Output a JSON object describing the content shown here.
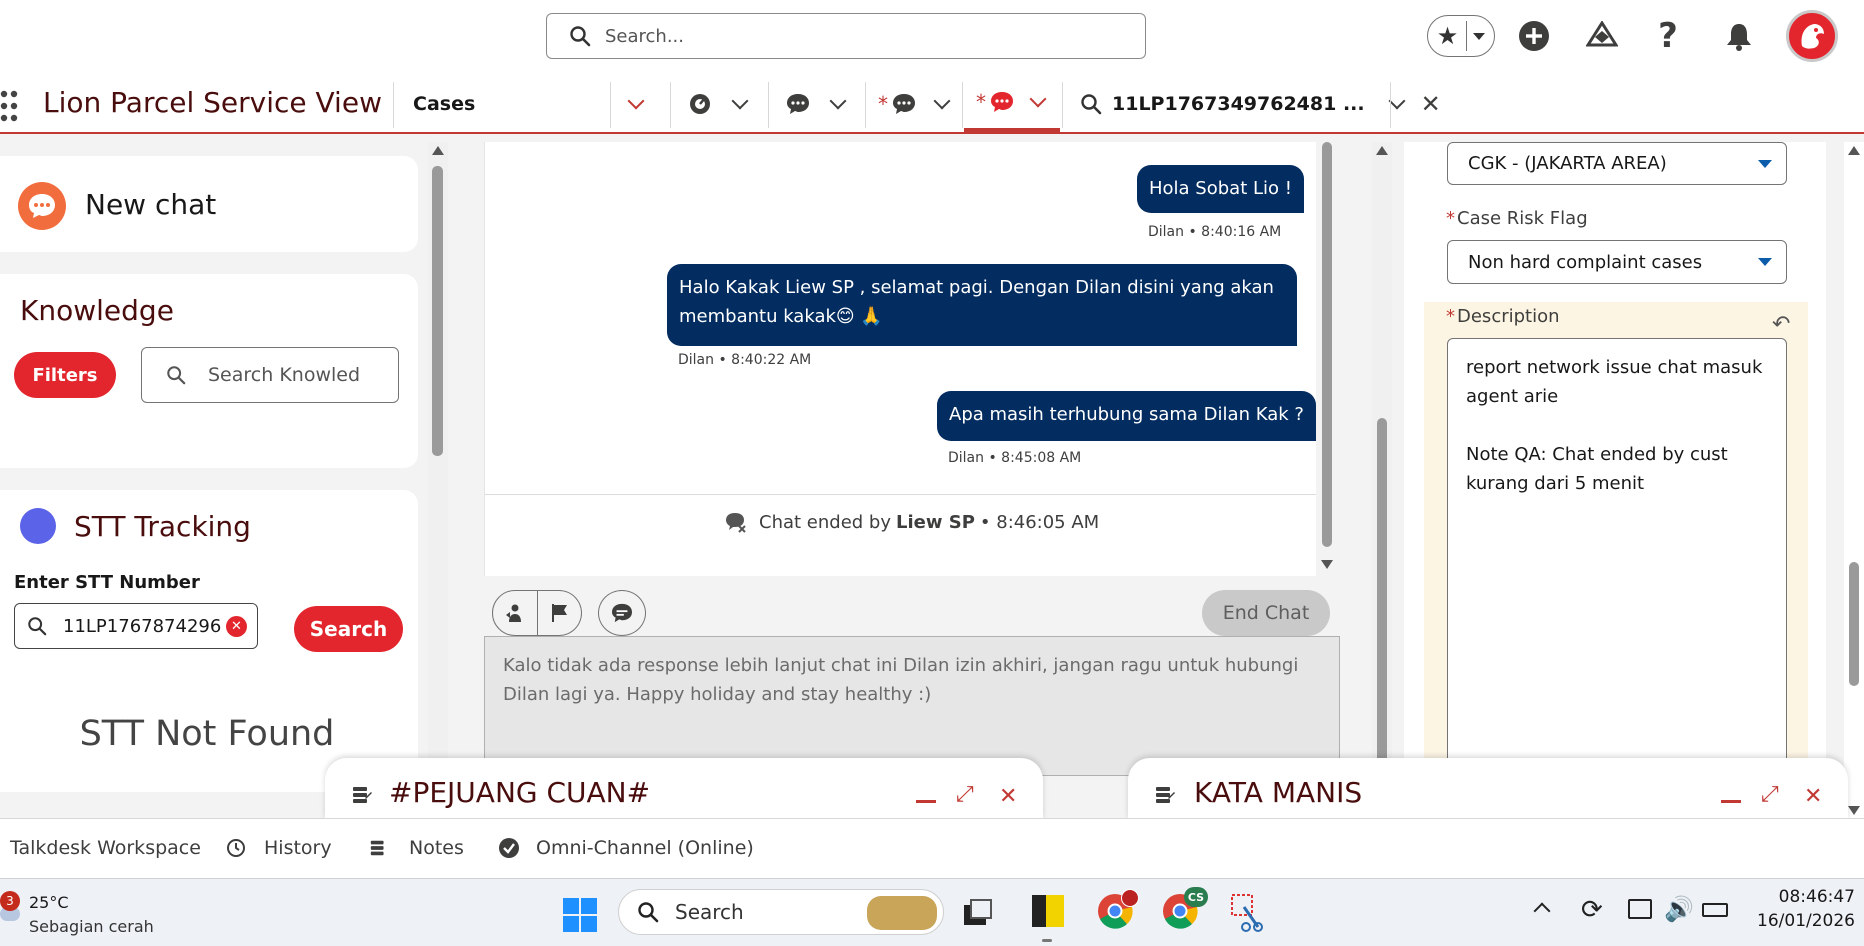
{
  "header": {
    "search_placeholder": "Search..."
  },
  "nav": {
    "app_name": "Lion Parcel Service View",
    "tab_object": "Cases",
    "tab_record_label": "11LP1767349762481 ..."
  },
  "new_chat": {
    "label": "New chat"
  },
  "knowledge": {
    "title": "Knowledge",
    "filters_label": "Filters",
    "search_placeholder": "Search Knowled"
  },
  "stt": {
    "title": "STT Tracking",
    "field_label": "Enter STT Number",
    "input_value": "11LP1767874296",
    "search_label": "Search",
    "result": "STT Not Found"
  },
  "chat": {
    "messages": [
      {
        "text": "Hola Sobat Lio !",
        "meta": "Dilan • 8:40:16 AM"
      },
      {
        "text_line1": "Halo Kakak Liew SP , selamat pagi. Dengan Dilan disini yang akan",
        "text_line2": "membantu kakak😊 🙏",
        "meta": "Dilan • 8:40:22 AM"
      },
      {
        "text": "Apa masih terhubung sama Dilan Kak ?",
        "meta": "Dilan • 8:45:08 AM"
      }
    ],
    "ended_prefix": "Chat ended by ",
    "ended_by": "Liew SP",
    "ended_time": " • 8:46:05 AM",
    "end_chat_label": "End Chat",
    "composer_text": "Kalo tidak ada response lebih lanjut chat ini Dilan izin akhiri, jangan ragu untuk hubungi Dilan lagi ya. Happy holiday and stay healthy :)"
  },
  "case_form": {
    "area_value": "CGK - (JAKARTA AREA)",
    "risk_label": "Case Risk Flag",
    "risk_value": "Non hard complaint cases",
    "description_label": "Description",
    "description_line1": "report network issue chat masuk",
    "description_line2": "agent arie",
    "description_line3": "Note QA: Chat ended by cust",
    "description_line4": "kurang dari 5 menit"
  },
  "docked": {
    "panel1_title": "#PEJUANG CUAN#",
    "panel2_title": "KATA MANIS"
  },
  "utility_bar": {
    "items": [
      "Talkdesk Workspace",
      "History",
      "Notes",
      "Omni-Channel (Online)"
    ]
  },
  "taskbar": {
    "weather_badge": "3",
    "weather_temp": "25°C",
    "weather_desc": "Sebagian cerah",
    "search_label": "Search",
    "chrome_profile_badge": "CS",
    "time": "08:46:47",
    "date": "16/01/2026"
  },
  "colors": {
    "brand_red": "#e3262e",
    "bubble_navy": "#032d60",
    "app_name": "#4a0d0d",
    "highlight": "#fdf5e4"
  }
}
